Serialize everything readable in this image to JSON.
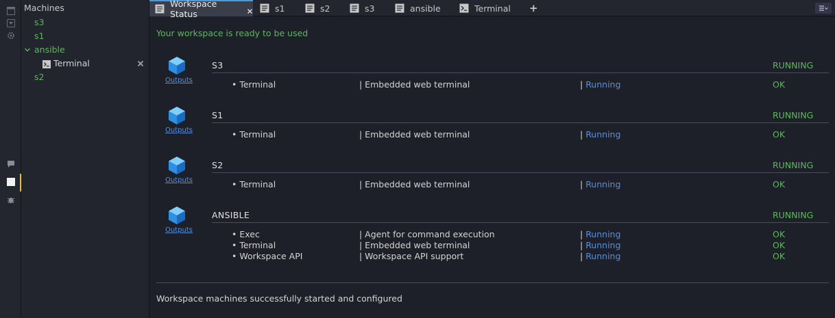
{
  "colors": {
    "accent_green": "#5fb65f",
    "link_blue": "#5b8fd6",
    "active_tab_border": "#4d9bd6",
    "activity_marker": "#f0b826"
  },
  "activity_bar": {
    "icons": [
      "window-icon",
      "download-icon",
      "gear-icon",
      "chat-icon",
      "panel-icon",
      "bug-icon"
    ]
  },
  "machines_panel": {
    "title": "Machines",
    "items": [
      {
        "label": "s3"
      },
      {
        "label": "s1"
      },
      {
        "label": "ansible",
        "expanded": true,
        "children": [
          {
            "label": "Terminal",
            "icon": "terminal-icon"
          }
        ]
      },
      {
        "label": "s2"
      }
    ]
  },
  "tabs": [
    {
      "label": "Workspace Status",
      "icon": "document-icon",
      "active": true,
      "closable": true
    },
    {
      "label": "s1",
      "icon": "document-icon"
    },
    {
      "label": "s2",
      "icon": "document-icon"
    },
    {
      "label": "s3",
      "icon": "document-icon"
    },
    {
      "label": "ansible",
      "icon": "document-icon"
    },
    {
      "label": "Terminal",
      "icon": "terminal-icon"
    }
  ],
  "tabbar": {
    "add_label": "+",
    "menu_icon": "hamburger-menu-icon"
  },
  "main": {
    "ready_text": "Your workspace is ready to be used",
    "outputs_label": "Outputs",
    "machines": [
      {
        "name": "S3",
        "status": "RUNNING",
        "agents": [
          {
            "name": "• Terminal",
            "desc": "| Embedded web terminal",
            "sep": "| ",
            "run": "Running",
            "ok": "OK"
          }
        ]
      },
      {
        "name": "S1",
        "status": "RUNNING",
        "agents": [
          {
            "name": "• Terminal",
            "desc": "| Embedded web terminal",
            "sep": "| ",
            "run": "Running",
            "ok": "OK"
          }
        ]
      },
      {
        "name": "S2",
        "status": "RUNNING",
        "agents": [
          {
            "name": "• Terminal",
            "desc": "| Embedded web terminal",
            "sep": "| ",
            "run": "Running",
            "ok": "OK"
          }
        ]
      },
      {
        "name": "ANSIBLE",
        "status": "RUNNING",
        "agents": [
          {
            "name": "• Exec",
            "desc": "| Agent for command execution",
            "sep": "| ",
            "run": "Running",
            "ok": "OK"
          },
          {
            "name": "• Terminal",
            "desc": "| Embedded web terminal",
            "sep": "| ",
            "run": "Running",
            "ok": "OK"
          },
          {
            "name": "• Workspace API",
            "desc": "| Workspace API support",
            "sep": "| ",
            "run": "Running",
            "ok": "OK"
          }
        ]
      }
    ],
    "done_text": "Workspace machines successfully started and configured"
  }
}
